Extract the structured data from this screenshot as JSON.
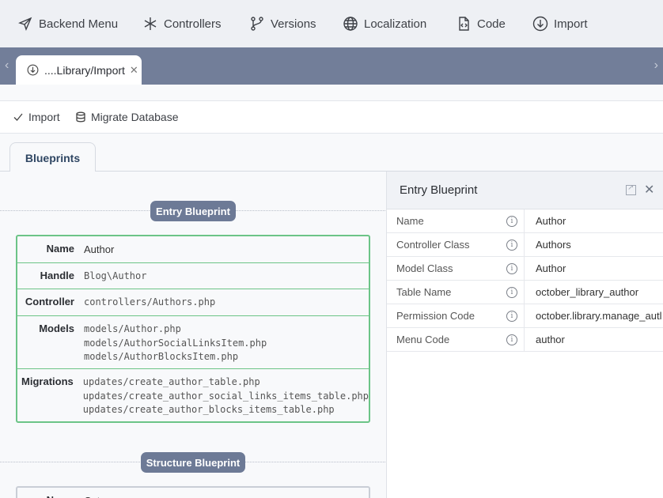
{
  "topmenu": [
    {
      "label": "Backend Menu",
      "icon": "send-icon"
    },
    {
      "label": "Controllers",
      "icon": "asterisk-icon"
    },
    {
      "label": "Versions",
      "icon": "git-branch-icon"
    },
    {
      "label": "Localization",
      "icon": "globe-icon"
    },
    {
      "label": "Code",
      "icon": "code-file-icon"
    },
    {
      "label": "Import",
      "icon": "import-icon"
    }
  ],
  "doc_tab": {
    "label": "....Library/Import",
    "icon": "import-icon"
  },
  "toolbar": {
    "import_label": "Import",
    "migrate_label": "Migrate Database"
  },
  "content_tab": {
    "label": "Blueprints"
  },
  "entry_blueprint": {
    "badge": "Entry Blueprint",
    "rows": {
      "name_key": "Name",
      "name_val": "Author",
      "handle_key": "Handle",
      "handle_val": "Blog\\Author",
      "controller_key": "Controller",
      "controller_val": "controllers/Authors.php",
      "models_key": "Models",
      "models": [
        "models/Author.php",
        "models/AuthorSocialLinksItem.php",
        "models/AuthorBlocksItem.php"
      ],
      "migrations_key": "Migrations",
      "migrations": [
        "updates/create_author_table.php",
        "updates/create_author_social_links_items_table.php",
        "updates/create_author_blocks_items_table.php"
      ]
    }
  },
  "structure_blueprint": {
    "badge": "Structure Blueprint",
    "name_key": "Name",
    "name_val": "Cat"
  },
  "inspector": {
    "title": "Entry Blueprint",
    "rows": [
      {
        "key": "Name",
        "value": "Author"
      },
      {
        "key": "Controller Class",
        "value": "Authors"
      },
      {
        "key": "Model Class",
        "value": "Author"
      },
      {
        "key": "Table Name",
        "value": "october_library_author"
      },
      {
        "key": "Permission Code",
        "value": "october.library.manage_autl"
      },
      {
        "key": "Menu Code",
        "value": "author"
      }
    ]
  },
  "colors": {
    "accent_green": "#6cc487",
    "tabstrip": "#727e99",
    "badge": "#6d7a96",
    "tab_text": "#2f4663"
  }
}
